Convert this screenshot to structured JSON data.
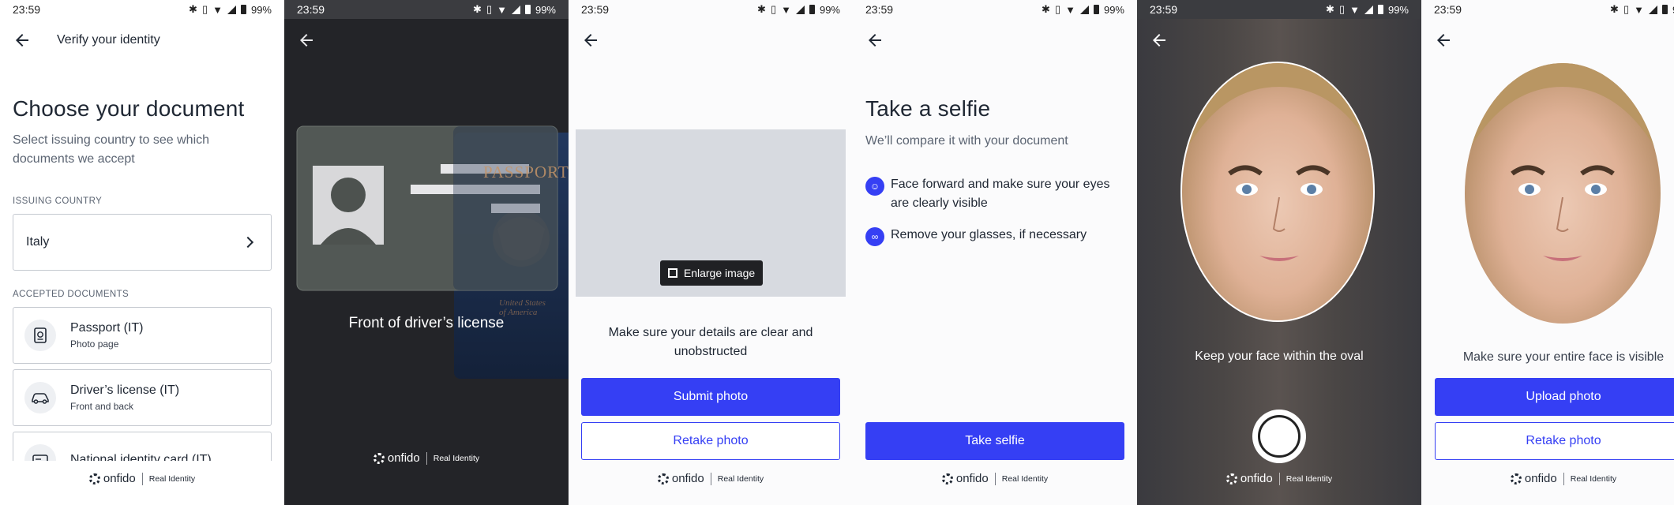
{
  "status": {
    "time": "23:59",
    "battery": "99%"
  },
  "colors": {
    "accent": "#353ff4"
  },
  "footer": {
    "brand": "onfido",
    "tagline": "Real Identity"
  },
  "screen1": {
    "nav_title": "Verify your identity",
    "heading": "Choose your document",
    "subtitle": "Select issuing country to see which documents we accept",
    "country_label": "ISSUING COUNTRY",
    "country_value": "Italy",
    "accepted_label": "ACCEPTED DOCUMENTS",
    "documents": [
      {
        "title": "Passport (IT)",
        "subtitle": "Photo page",
        "icon": "passport-icon"
      },
      {
        "title": "Driver’s license (IT)",
        "subtitle": "Front and back",
        "icon": "car-icon"
      },
      {
        "title": "National identity card (IT)",
        "subtitle": "",
        "icon": "id-card-icon"
      }
    ]
  },
  "screen2": {
    "caption": "Front of driver’s license",
    "passport_text": "PASSPORT",
    "passport_small": "United States of America"
  },
  "screen3": {
    "enlarge_label": "Enlarge image",
    "instruction": "Make sure your details are clear and unobstructed",
    "submit_label": "Submit photo",
    "retake_label": "Retake photo"
  },
  "screen4": {
    "heading": "Take a selfie",
    "subtitle": "We’ll compare it with your document",
    "tips": [
      {
        "icon": "face-icon",
        "text": "Face forward and make sure your eyes are clearly visible"
      },
      {
        "icon": "glasses-icon",
        "text": "Remove your glasses, if necessary"
      }
    ],
    "button_label": "Take selfie"
  },
  "screen5": {
    "instruction": "Keep your face within the oval"
  },
  "screen6": {
    "instruction": "Make sure your entire face is visible",
    "upload_label": "Upload photo",
    "retake_label": "Retake photo"
  }
}
